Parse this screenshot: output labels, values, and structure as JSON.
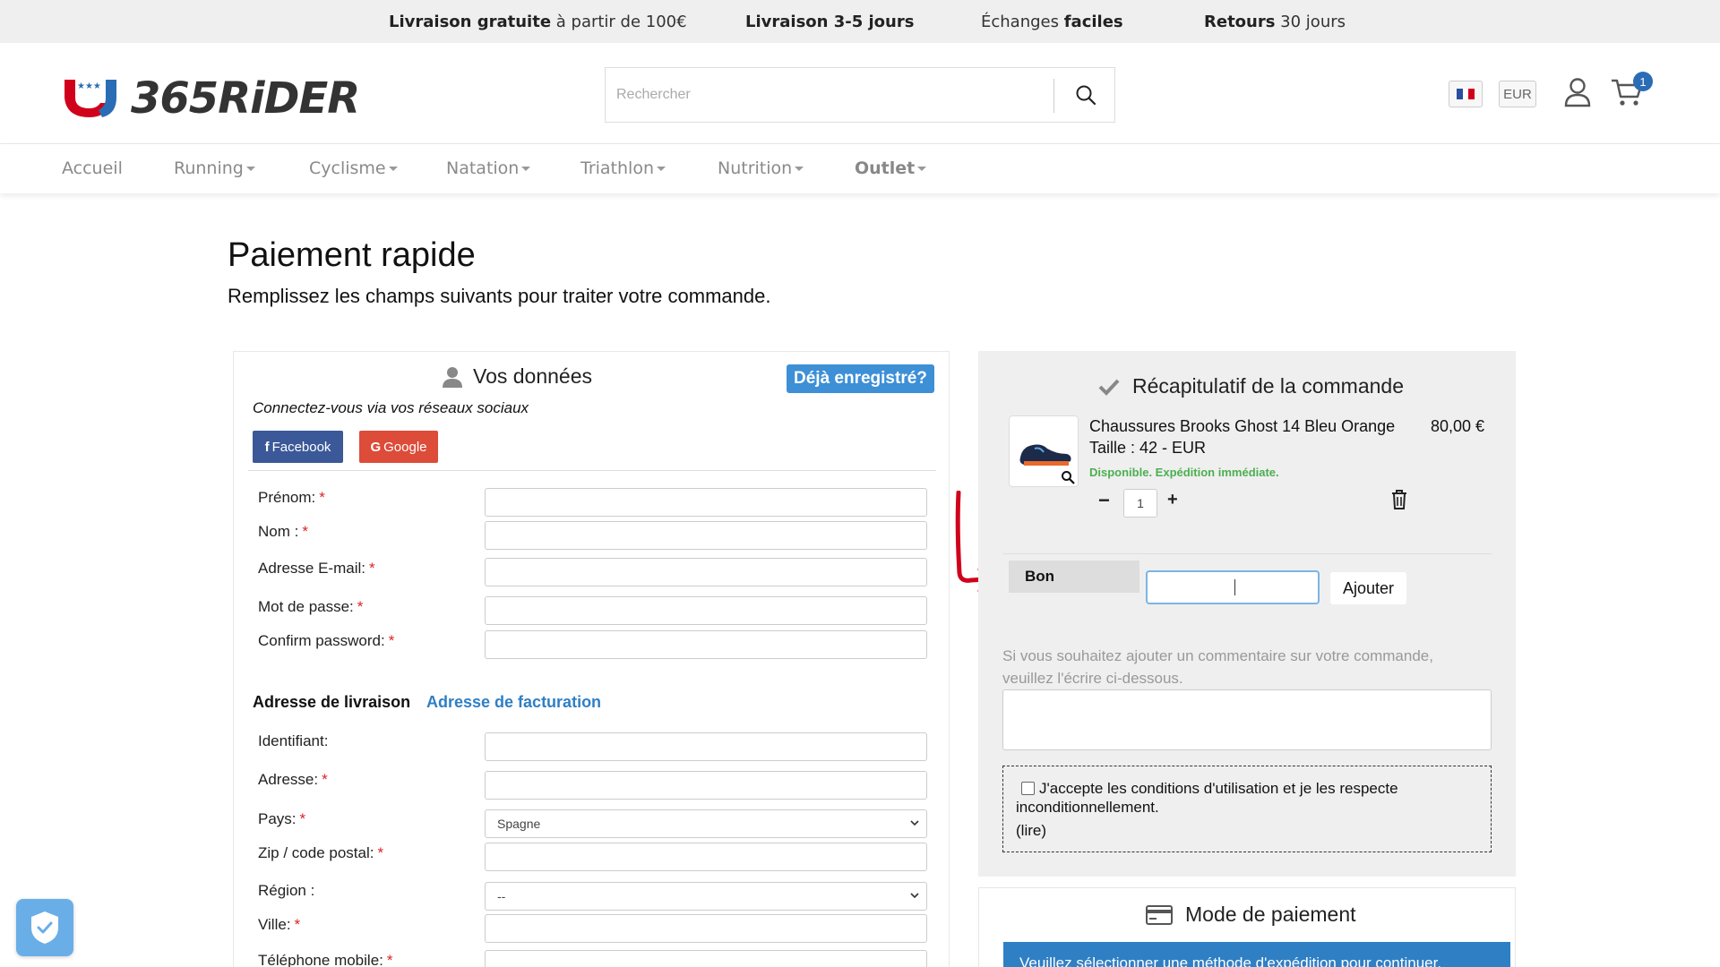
{
  "promo": {
    "items": [
      {
        "bold": "Livraison gratuite",
        "rest": " à partir de 100€"
      },
      {
        "bold": "Livraison 3-5 jours",
        "rest": ""
      },
      {
        "pre": "Échanges ",
        "bold": "faciles"
      },
      {
        "bold": "Retours",
        "rest": " 30 jours"
      }
    ]
  },
  "header": {
    "logo_text": "365RiDER",
    "search_placeholder": "Rechercher",
    "currency": "EUR",
    "cart_count": "1"
  },
  "nav": {
    "items": [
      "Accueil",
      "Running",
      "Cyclisme",
      "Natation",
      "Triathlon",
      "Nutrition",
      "Outlet"
    ]
  },
  "page": {
    "title": "Paiement rapide",
    "subtitle": "Remplissez les champs suivants pour traiter votre commande."
  },
  "form": {
    "section_title": "Vos données",
    "already_registered": "Déjà enregistré?",
    "social_label": "Connectez-vous via vos réseaux sociaux",
    "facebook_label": "Facebook",
    "google_label": "Google",
    "fields": {
      "prenom": "Prénom:",
      "nom": "Nom :",
      "email": "Adresse E-mail:",
      "password": "Mot de passe:",
      "confirm": "Confirm password:",
      "identifiant": "Identifiant:",
      "adresse": "Adresse:",
      "pays": "Pays:",
      "zip": "Zip / code postal:",
      "region": "Région :",
      "ville": "Ville:",
      "telephone": "Téléphone mobile:"
    },
    "required_mark": "*",
    "shipping_tab": "Adresse de livraison",
    "billing_tab": "Adresse de facturation",
    "country_value": "Spagne",
    "region_value": "--"
  },
  "summary": {
    "title": "Récapitulatif de la commande",
    "product": {
      "name": "Chaussures Brooks Ghost 14 Bleu Orange",
      "size": "Taille : 42 - EUR",
      "availability": "Disponible. Expédition immédiate.",
      "price": "80,00 €",
      "quantity": "1"
    },
    "coupon_label": "Bon",
    "coupon_button": "Ajouter",
    "comment_hint": "Si vous souhaitez ajouter un commentaire sur votre commande, veuillez l'écrire ci-dessous.",
    "terms_text": "J'accepte les conditions d'utilisation et je les respecte inconditionnellement.",
    "terms_link": "(lire)"
  },
  "payment": {
    "title": "Mode de paiement",
    "notice": "Veuillez sélectionner une méthode d'expédition pour continuer."
  },
  "colors": {
    "accent_blue": "#2f7fc4",
    "facebook": "#3b5998",
    "google": "#dd4b39",
    "available_green": "#4caf50",
    "annotation_red": "#d0021b"
  }
}
